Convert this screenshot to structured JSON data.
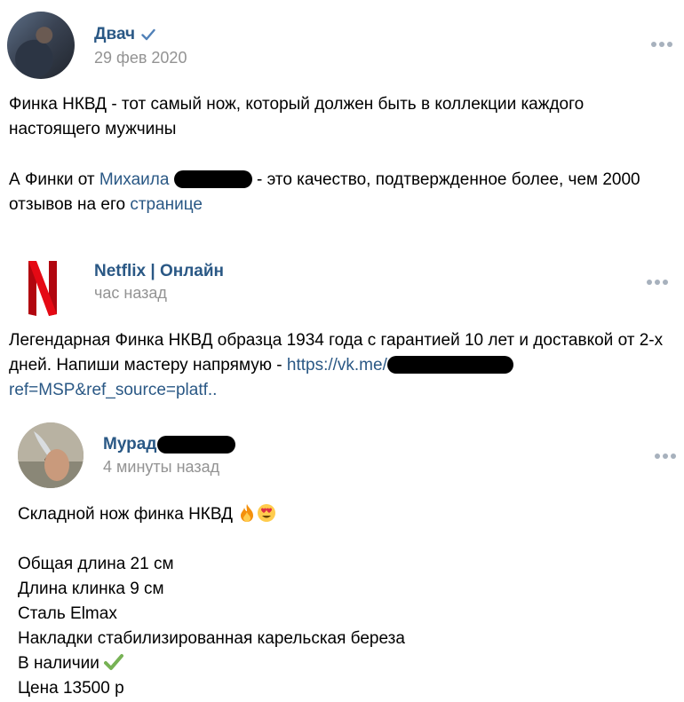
{
  "posts": [
    {
      "author": "Двач",
      "time": "29 фев 2020",
      "text1": "Финка НКВД - тот самый нож, который должен быть в коллекции каждого настоящего мужчины",
      "text2_a": "А Финки от ",
      "text2_link1": "Михаила",
      "text2_b": " - это качество, подтвержденное более, чем 2000 отзывов на его ",
      "text2_link2": "странице"
    },
    {
      "author": "Netflix | Онлайн",
      "time": "час назад",
      "text_a": "Легендарная Финка НКВД образца 1934 года с гарантией 10 лет и доставкой от 2-х дней. Напиши мастеру напрямую - ",
      "link_a": "https://vk.me/",
      "link_b": "ref=MSP&ref_source=platf..",
      "logo_letter": "N"
    },
    {
      "author": "Мурад",
      "time": "4 минуты назад",
      "line1": "Складной нож финка НКВД",
      "line2": "Общая длина 21 см",
      "line3": "Длина клинка 9 см",
      "line4": "Сталь Elmax",
      "line5": "Накладки стабилизированная карельская береза",
      "line6": "В наличии",
      "line7": "Цена 13500 р"
    }
  ],
  "colors": {
    "link": "#2a5885",
    "meta": "#939393",
    "netflix_red": "#e50914",
    "check_green": "#77b255"
  }
}
